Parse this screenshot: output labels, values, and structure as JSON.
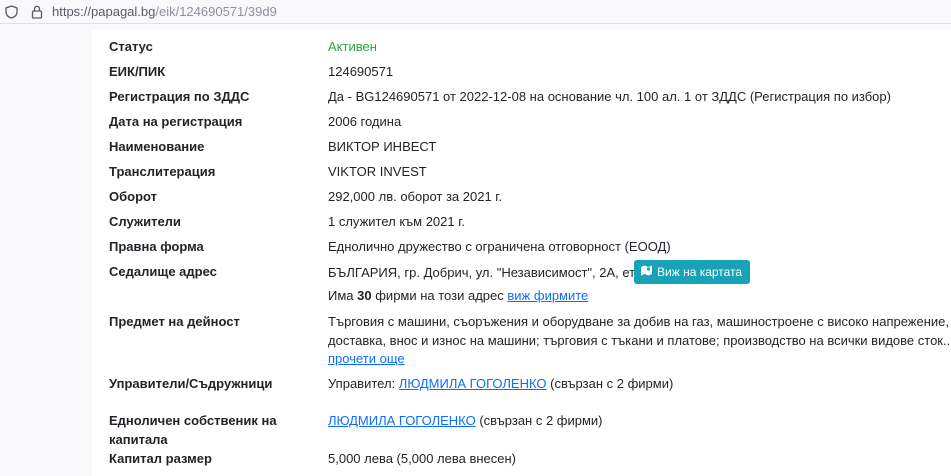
{
  "browser": {
    "url_host": "https://papagal.bg",
    "url_path": "/eik/124690571/39d9"
  },
  "rows": [
    {
      "label": "Статус",
      "value": "Активен"
    },
    {
      "label": "ЕИК/ПИК",
      "value": "124690571"
    },
    {
      "label": "Регистрация по ЗДДС",
      "value": "Да - BG124690571 от 2022-12-08 на основание чл. 100 ал. 1 от ЗДДС (Регистрация по избор)"
    },
    {
      "label": "Дата на регистрация",
      "value": "2006 година"
    },
    {
      "label": "Наименование",
      "value": "ВИКТОР ИНВЕСТ"
    },
    {
      "label": "Транслитерация",
      "value": "VIKTOR INVEST"
    },
    {
      "label": "Оборот",
      "value": "292,000 лв. оборот за 2021 г."
    },
    {
      "label": "Служители",
      "value": "1 служител към 2021 г."
    },
    {
      "label": "Правна форма",
      "value": "Еднолично дружество с ограничена отговорност (ЕООД)"
    }
  ],
  "address": {
    "label": "Седалище адрес",
    "value": "БЪЛГАРИЯ, гр. Добрич, ул. \"Независимост\", 2А, ет. 3",
    "map_button": "Виж на картата",
    "firms_prefix": "Има",
    "firms_count": "30",
    "firms_suffix": "фирми на този адрес",
    "firms_link": "виж фирмите"
  },
  "activity": {
    "label": "Предмет на дейност",
    "line1": "Търговия с машини, съоръжения и оборудване за добив на газ, машиностроене с високо напрежение,",
    "line2": "доставка, внос и износ на машини; търговия с тъкани и платове; производство на всички видове сток...",
    "more_link": "прочети още"
  },
  "managers": {
    "label": "Управители/Съдружници",
    "prefix": "Управител:",
    "name": "ЛЮДМИЛА ГОГОЛЕНКО",
    "suffix": "(свързан с 2 фирми)"
  },
  "owner": {
    "label_line1": "Едноличен собственик на",
    "label_line2": "капитала",
    "name": "ЛЮДМИЛА ГОГОЛЕНКО",
    "suffix": "(свързан с 2 фирми)"
  },
  "capital": {
    "label": "Капитал размер",
    "value": "5,000 лева (5,000 лева внесен)"
  },
  "colors": {
    "active": "#28a745",
    "link": "#0d6efd",
    "map_button": "#17a2b8"
  }
}
